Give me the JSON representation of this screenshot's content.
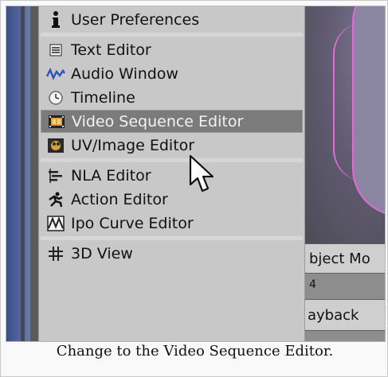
{
  "menu": {
    "items": [
      {
        "label": "User Preferences",
        "icon": "info-icon"
      },
      {
        "label": "Text Editor",
        "icon": "text-editor-icon"
      },
      {
        "label": "Audio Window",
        "icon": "audio-wave-icon"
      },
      {
        "label": "Timeline",
        "icon": "clock-icon"
      },
      {
        "label": "Video Sequence Editor",
        "icon": "film-strip-icon",
        "active": true
      },
      {
        "label": "UV/Image Editor",
        "icon": "image-icon"
      },
      {
        "label": "NLA Editor",
        "icon": "nla-icon"
      },
      {
        "label": "Action Editor",
        "icon": "action-icon"
      },
      {
        "label": "Ipo Curve Editor",
        "icon": "curve-icon"
      },
      {
        "label": "3D View",
        "icon": "grid-icon"
      }
    ]
  },
  "header": {
    "mode_label": "bject Mo",
    "frame_number": "4",
    "playback_label": "ayback"
  },
  "caption": "Change to the Video Sequence Editor.",
  "colors": {
    "menu_bg": "#c8c8c8",
    "active_bg": "#7b7b7b",
    "outline": "#e36ad7"
  }
}
